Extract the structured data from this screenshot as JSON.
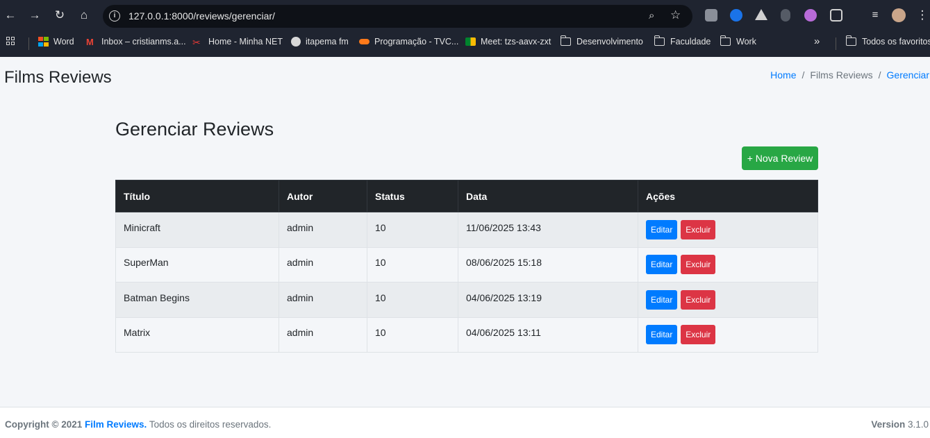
{
  "browser": {
    "url": "127.0.0.1:8000/reviews/gerenciar/",
    "bookmarks": [
      {
        "label": "Word",
        "icon": "microsoft-icon"
      },
      {
        "label": "Inbox – cristianms.a...",
        "icon": "gmail-icon"
      },
      {
        "label": "Home - Minha NET",
        "icon": "net-icon"
      },
      {
        "label": "itapema fm",
        "icon": "globe-icon"
      },
      {
        "label": "Programação - TVC...",
        "icon": "tvc-icon"
      },
      {
        "label": "Meet: tzs-aavx-zxt",
        "icon": "meet-icon"
      },
      {
        "label": "Desenvolvimento",
        "icon": "folder-icon"
      },
      {
        "label": "Faculdade",
        "icon": "folder-icon"
      },
      {
        "label": "Work",
        "icon": "folder-icon"
      }
    ],
    "more_bookmarks": "»",
    "all_bookmarks": "Todos os favoritos"
  },
  "header": {
    "brand": "Films Reviews",
    "breadcrumb": [
      "Home",
      "Films Reviews",
      "Gerenciar"
    ]
  },
  "main": {
    "title": "Gerenciar Reviews",
    "new_button": "+ Nova Review",
    "columns": [
      "Título",
      "Autor",
      "Status",
      "Data",
      "Ações"
    ],
    "rows": [
      {
        "titulo": "Minicraft",
        "autor": "admin",
        "status": "10",
        "data": "11/06/2025 13:43"
      },
      {
        "titulo": "SuperMan",
        "autor": "admin",
        "status": "10",
        "data": "08/06/2025 15:18"
      },
      {
        "titulo": "Batman Begins",
        "autor": "admin",
        "status": "10",
        "data": "04/06/2025 13:19"
      },
      {
        "titulo": "Matrix",
        "autor": "admin",
        "status": "10",
        "data": "04/06/2025 13:11"
      }
    ],
    "edit_label": "Editar",
    "delete_label": "Excluir"
  },
  "footer": {
    "copyright": "Copyright © 2021",
    "site_name": "Film Reviews.",
    "rights": "Todos os direitos reservados.",
    "version_label": "Version",
    "version_number": "3.1.0"
  },
  "colors": {
    "success": "#28a745",
    "primary": "#007bff",
    "danger": "#dc3545",
    "table_header": "#212529"
  }
}
